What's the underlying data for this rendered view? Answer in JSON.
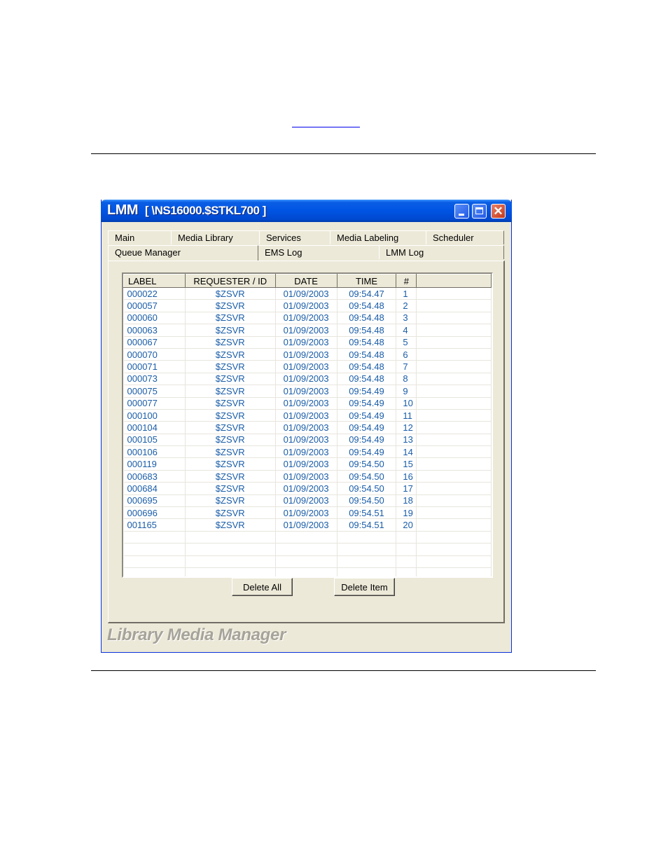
{
  "window": {
    "app": "LMM",
    "subtitle": "[ \\NS16000.$STKL700 ]"
  },
  "tabs": {
    "row1": [
      "Main",
      "Media Library",
      "Services",
      "Media Labeling",
      "Scheduler"
    ],
    "row2": [
      "Queue Manager",
      "EMS Log",
      "LMM Log"
    ],
    "active": "Queue Manager"
  },
  "table": {
    "columns": [
      "LABEL",
      "REQUESTER / ID",
      "DATE",
      "TIME",
      "#"
    ],
    "rows": [
      [
        "000022",
        "$ZSVR",
        "01/09/2003",
        "09:54.47",
        "1"
      ],
      [
        "000057",
        "$ZSVR",
        "01/09/2003",
        "09:54.48",
        "2"
      ],
      [
        "000060",
        "$ZSVR",
        "01/09/2003",
        "09:54.48",
        "3"
      ],
      [
        "000063",
        "$ZSVR",
        "01/09/2003",
        "09:54.48",
        "4"
      ],
      [
        "000067",
        "$ZSVR",
        "01/09/2003",
        "09:54.48",
        "5"
      ],
      [
        "000070",
        "$ZSVR",
        "01/09/2003",
        "09:54.48",
        "6"
      ],
      [
        "000071",
        "$ZSVR",
        "01/09/2003",
        "09:54.48",
        "7"
      ],
      [
        "000073",
        "$ZSVR",
        "01/09/2003",
        "09:54.48",
        "8"
      ],
      [
        "000075",
        "$ZSVR",
        "01/09/2003",
        "09:54.49",
        "9"
      ],
      [
        "000077",
        "$ZSVR",
        "01/09/2003",
        "09:54.49",
        "10"
      ],
      [
        "000100",
        "$ZSVR",
        "01/09/2003",
        "09:54.49",
        "11"
      ],
      [
        "000104",
        "$ZSVR",
        "01/09/2003",
        "09:54.49",
        "12"
      ],
      [
        "000105",
        "$ZSVR",
        "01/09/2003",
        "09:54.49",
        "13"
      ],
      [
        "000106",
        "$ZSVR",
        "01/09/2003",
        "09:54.49",
        "14"
      ],
      [
        "000119",
        "$ZSVR",
        "01/09/2003",
        "09:54.50",
        "15"
      ],
      [
        "000683",
        "$ZSVR",
        "01/09/2003",
        "09:54.50",
        "16"
      ],
      [
        "000684",
        "$ZSVR",
        "01/09/2003",
        "09:54.50",
        "17"
      ],
      [
        "000695",
        "$ZSVR",
        "01/09/2003",
        "09:54.50",
        "18"
      ],
      [
        "000696",
        "$ZSVR",
        "01/09/2003",
        "09:54.51",
        "19"
      ],
      [
        "001165",
        "$ZSVR",
        "01/09/2003",
        "09:54.51",
        "20"
      ]
    ]
  },
  "buttons": {
    "delete_all": "Delete All",
    "delete_item": "Delete Item"
  },
  "footer": {
    "brand": "Library Media Manager"
  },
  "icons": {
    "minimize": "minimize-icon",
    "maximize": "maximize-icon",
    "close": "close-icon"
  },
  "colors": {
    "titlebar": "#0054e3",
    "window_bg": "#ece9d8",
    "cell_text": "#1a5da8"
  }
}
